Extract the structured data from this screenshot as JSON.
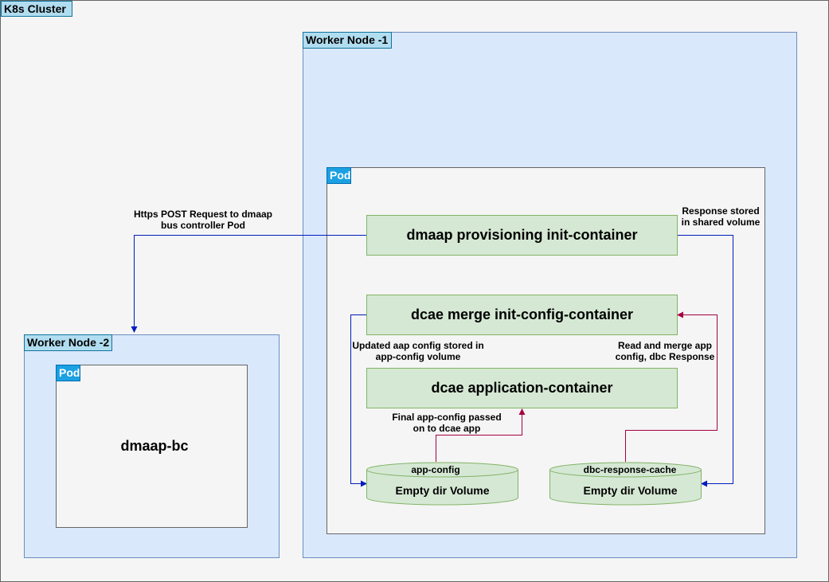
{
  "cluster": {
    "label": "K8s Cluster"
  },
  "worker_node_1": {
    "label": "Worker Node -1"
  },
  "worker_node_2": {
    "label": "Worker Node -2"
  },
  "pod_main": {
    "label": "Pod"
  },
  "pod_bc": {
    "label": "Pod",
    "content": "dmaap-bc"
  },
  "containers": {
    "provisioning": "dmaap provisioning init-container",
    "merge": "dcae merge init-config-container",
    "application": "dcae application-container"
  },
  "volumes": {
    "app_config": {
      "name": "app-config",
      "label": "Empty dir Volume"
    },
    "dbc_cache": {
      "name": "dbc-response-cache",
      "label": "Empty dir Volume"
    }
  },
  "annotations": {
    "https_post": [
      "Https POST Request to dmaap",
      "bus controller Pod"
    ],
    "response_stored": [
      "Response stored",
      "in shared volume"
    ],
    "updated_config": [
      "Updated aap config stored in",
      "app-config volume"
    ],
    "read_merge": [
      "Read and merge app",
      "config, dbc Response"
    ],
    "final_config": [
      "Final app-config passed",
      "on to dcae app"
    ]
  },
  "colors": {
    "node_fill": "#dae8fc",
    "label_fill": "#1ba1e2",
    "container_fill": "#d5e8d4",
    "blue_arrow": "#001DBC",
    "red_arrow": "#A50040"
  }
}
